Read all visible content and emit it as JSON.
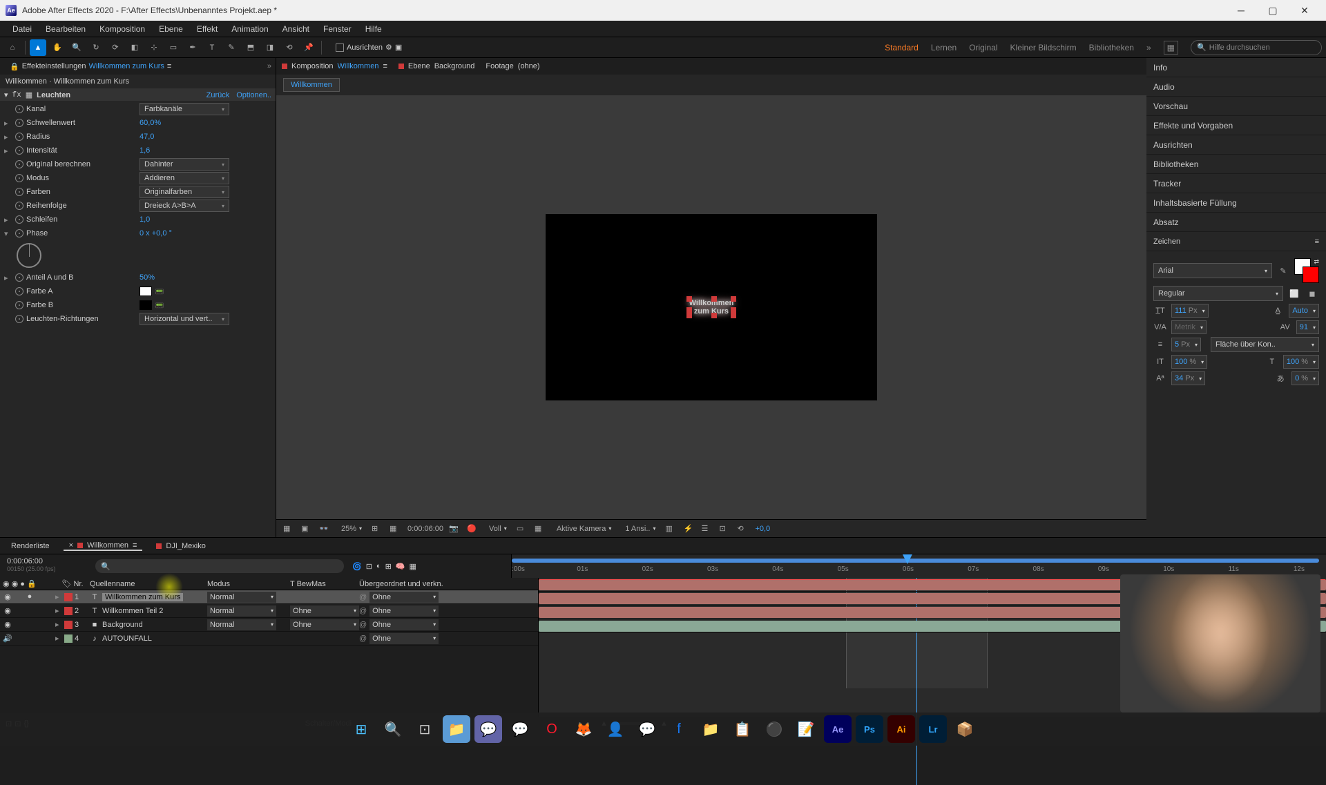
{
  "window": {
    "title": "Adobe After Effects 2020 - F:\\After Effects\\Unbenanntes Projekt.aep *"
  },
  "menu": {
    "items": [
      "Datei",
      "Bearbeiten",
      "Komposition",
      "Ebene",
      "Effekt",
      "Animation",
      "Ansicht",
      "Fenster",
      "Hilfe"
    ]
  },
  "toolbar": {
    "ausrichten": "Ausrichten"
  },
  "workspace": {
    "items": [
      "Standard",
      "Lernen",
      "Original",
      "Kleiner Bildschirm",
      "Bibliotheken"
    ],
    "search": "Hilfe durchsuchen"
  },
  "effectPanel": {
    "tabLabel": "Effekteinstellungen",
    "tabLinked": "Willkommen zum Kurs",
    "breadcrumb": "Willkommen · Willkommen zum Kurs",
    "fxName": "Leuchten",
    "back": "Zurück",
    "options": "Optionen..",
    "props": {
      "kanal": "Kanal",
      "kanal_v": "Farbkanäle",
      "schwellenwert": "Schwellenwert",
      "schwellenwert_v": "60,0%",
      "radius": "Radius",
      "radius_v": "47,0",
      "intensitaet": "Intensität",
      "intensitaet_v": "1,6",
      "original": "Original berechnen",
      "original_v": "Dahinter",
      "modus": "Modus",
      "modus_v": "Addieren",
      "farben": "Farben",
      "farben_v": "Originalfarben",
      "reihenfolge": "Reihenfolge",
      "reihenfolge_v": "Dreieck A>B>A",
      "schleifen": "Schleifen",
      "schleifen_v": "1,0",
      "phase": "Phase",
      "phase_v": "0 x +0,0 °",
      "anteil": "Anteil A und B",
      "anteil_v": "50%",
      "farbeA": "Farbe A",
      "farbeB": "Farbe B",
      "richtungen": "Leuchten-Richtungen",
      "richtungen_v": "Horizontal und vert.."
    }
  },
  "compPanel": {
    "tabs": [
      {
        "prefix": "Komposition",
        "name": "Willkommen",
        "active": true
      },
      {
        "prefix": "Ebene",
        "name": "Background"
      },
      {
        "prefix": "Footage",
        "name": "(ohne)"
      }
    ],
    "breadcrumb": "Willkommen",
    "text": "Willkommen zum Kurs",
    "zoom": "25%",
    "timecode": "0:00:06:00",
    "view": "Voll",
    "camera": "Aktive Kamera",
    "views": "1 Ansi..",
    "exposure": "+0,0"
  },
  "rightPanel": {
    "headers": [
      "Info",
      "Audio",
      "Vorschau",
      "Effekte und Vorgaben",
      "Ausrichten",
      "Bibliotheken",
      "Tracker",
      "Inhaltsbasierte Füllung",
      "Absatz"
    ],
    "zeichen": "Zeichen",
    "font": "Arial",
    "style": "Regular",
    "size": "111",
    "sizeUnit": "Px",
    "leading": "Auto",
    "tracking_l": "Metrik",
    "tracking_r": "91",
    "stroke": "5",
    "strokeUnit": "Px",
    "strokeOrder": "Fläche über Kon..",
    "scaleH": "100",
    "scaleV": "100",
    "pct": "%",
    "baseline": "34",
    "tsume": "0"
  },
  "timeline": {
    "tabs": [
      {
        "name": "Renderliste"
      },
      {
        "name": "Willkommen",
        "active": true
      },
      {
        "name": "DJI_Mexiko"
      }
    ],
    "timecode": "0:00:06:00",
    "fpsinfo": "00150 (25.00 fps)",
    "columns": {
      "num": "Nr.",
      "source": "Quellenname",
      "mode": "Modus",
      "t": "T",
      "trkmat": "BewMas",
      "parent": "Übergeordnet und verkn."
    },
    "layers": [
      {
        "num": "1",
        "color": "#d03a3a",
        "icon": "T",
        "name": "Willkommen zum Kurs",
        "mode": "Normal",
        "trkmat": "",
        "parent": "Ohne",
        "selected": true
      },
      {
        "num": "2",
        "color": "#d03a3a",
        "icon": "T",
        "name": "Willkommen Teil 2",
        "mode": "Normal",
        "trkmat": "Ohne",
        "parent": "Ohne"
      },
      {
        "num": "3",
        "color": "#d03a3a",
        "icon": "■",
        "name": "Background",
        "mode": "Normal",
        "trkmat": "Ohne",
        "parent": "Ohne"
      },
      {
        "num": "4",
        "color": "#88aa88",
        "icon": "♪",
        "name": "AUTOUNFALL",
        "mode": "",
        "trkmat": "",
        "parent": "Ohne"
      }
    ],
    "ticks": [
      ":00s",
      "01s",
      "02s",
      "03s",
      "04s",
      "05s",
      "06s",
      "07s",
      "08s",
      "09s",
      "10s",
      "11s",
      "12s"
    ],
    "footer": "Schalter/Modi"
  }
}
